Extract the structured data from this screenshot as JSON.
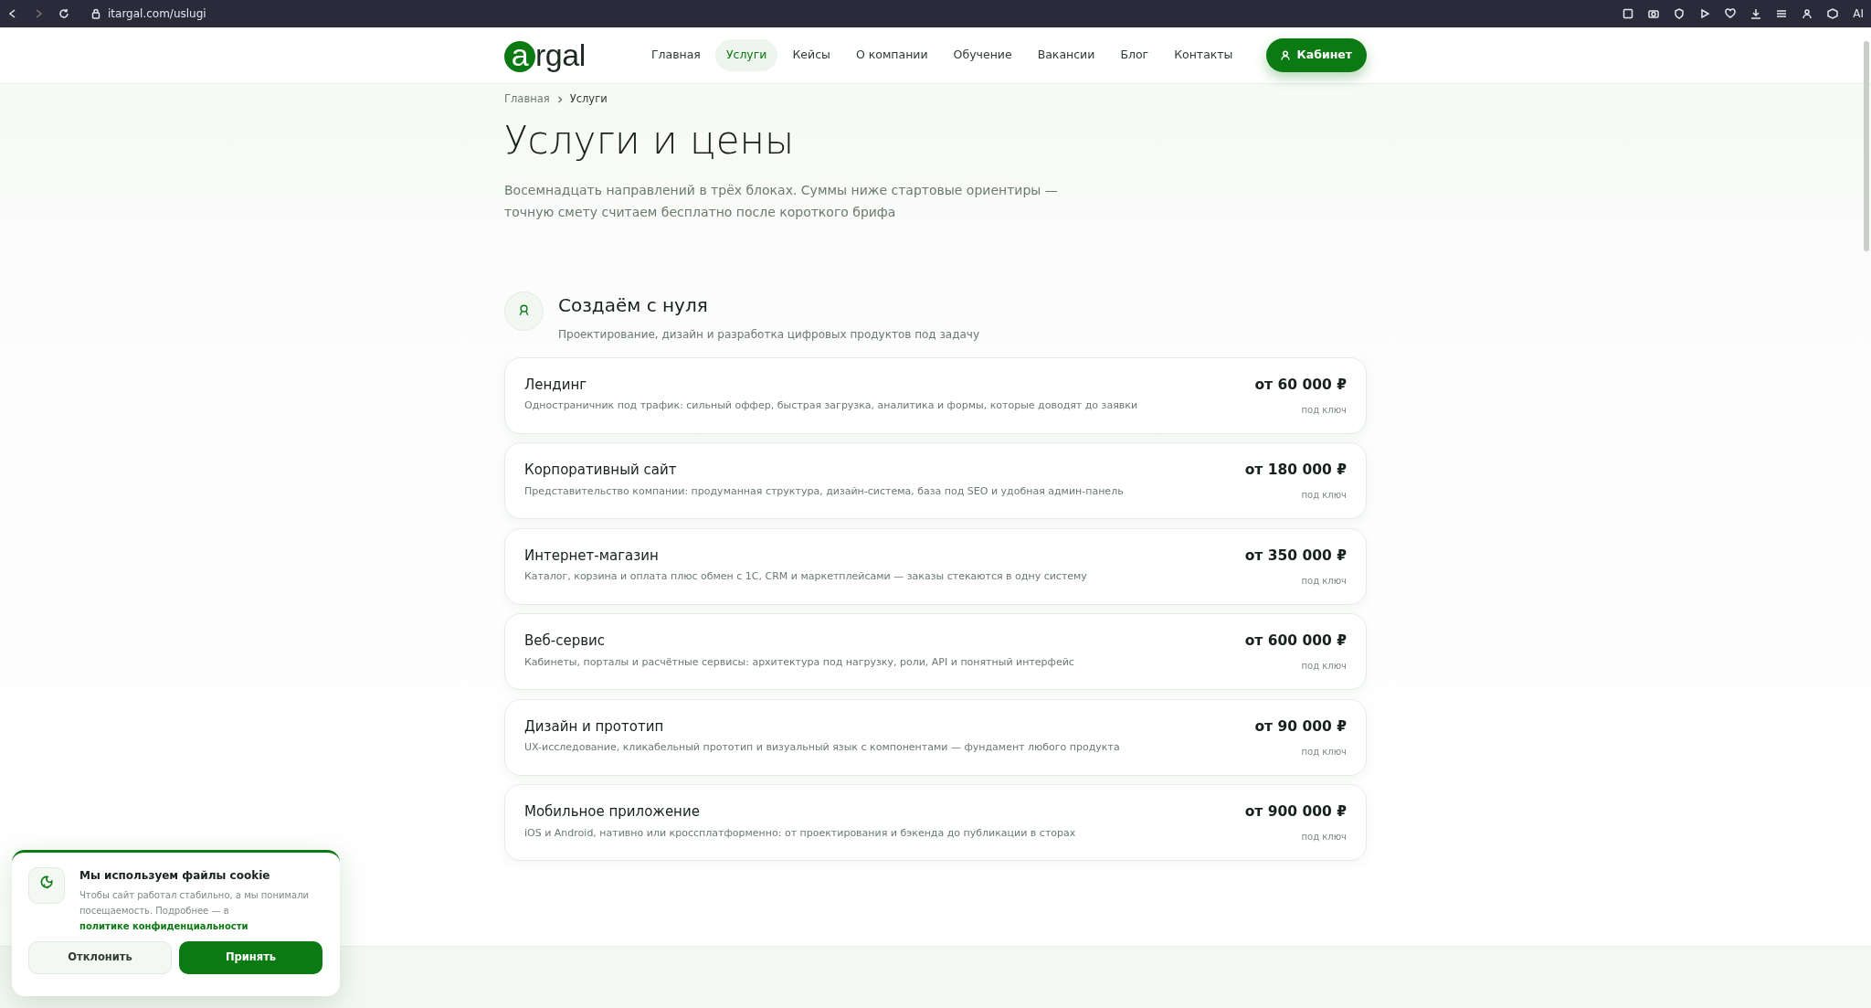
{
  "browser": {
    "url": "itargal.com/uslugi",
    "ai_label": "AI"
  },
  "header": {
    "logo": {
      "lead": "a",
      "rest": "rgal"
    },
    "nav": [
      {
        "label": "Главная",
        "selected": false
      },
      {
        "label": "Услуги",
        "selected": true
      },
      {
        "label": "Кейсы",
        "selected": false
      },
      {
        "label": "О компании",
        "selected": false
      },
      {
        "label": "Обучение",
        "selected": false
      },
      {
        "label": "Вакансии",
        "selected": false
      },
      {
        "label": "Блог",
        "selected": false
      },
      {
        "label": "Контакты",
        "selected": false
      }
    ],
    "cabinet_button": "Кабинет"
  },
  "breadcrumbs": [
    "Главная",
    "Услуги"
  ],
  "title": "Услуги и цены",
  "intro": [
    "Восемнадцать направлений в трёх блоках. Суммы ниже стартовые ориентиры —",
    "точную смету считаем бесплатно после короткого брифа"
  ],
  "section": {
    "title": "Создаём с нуля",
    "subtitle": "Проектирование, дизайн и разработка цифровых продуктов под задачу",
    "services": [
      {
        "name": "Лендинг",
        "description": "Одностраничник под трафик: сильный оффер, быстрая загрузка, аналитика и формы, которые доводят до заявки",
        "price": "от 60 000 ₽",
        "note": "под ключ"
      },
      {
        "name": "Корпоративный сайт",
        "description": "Представительство компании: продуманная структура, дизайн-система, база под SEO и удобная админ-панель",
        "price": "от 180 000 ₽",
        "note": "под ключ"
      },
      {
        "name": "Интернет-магазин",
        "description": "Каталог, корзина и оплата плюс обмен с 1С, CRM и маркетплейсами — заказы стекаются в одну систему",
        "price": "от 350 000 ₽",
        "note": "под ключ"
      },
      {
        "name": "Веб-сервис",
        "description": "Кабинеты, порталы и расчётные сервисы: архитектура под нагрузку, роли, API и понятный интерфейс",
        "price": "от 600 000 ₽",
        "note": "под ключ"
      },
      {
        "name": "Дизайн и прототип",
        "description": "UX-исследование, кликабельный прототип и визуальный язык с компонентами — фундамент любого продукта",
        "price": "от 90 000 ₽",
        "note": "под ключ"
      },
      {
        "name": "Мобильное приложение",
        "description": "iOS и Android, нативно или кроссплатформенно: от проектирования и бэкенда до публикации в сторах",
        "price": "от 900 000 ₽",
        "note": "под ключ"
      }
    ]
  },
  "cookie": {
    "title": "Мы используем файлы cookie",
    "text": "Чтобы сайт работал стабильно, а мы понимали посещаемость. Подробнее — в",
    "link": "политике конфиденциальности",
    "decline": "Отклонить",
    "accept": "Принять"
  }
}
